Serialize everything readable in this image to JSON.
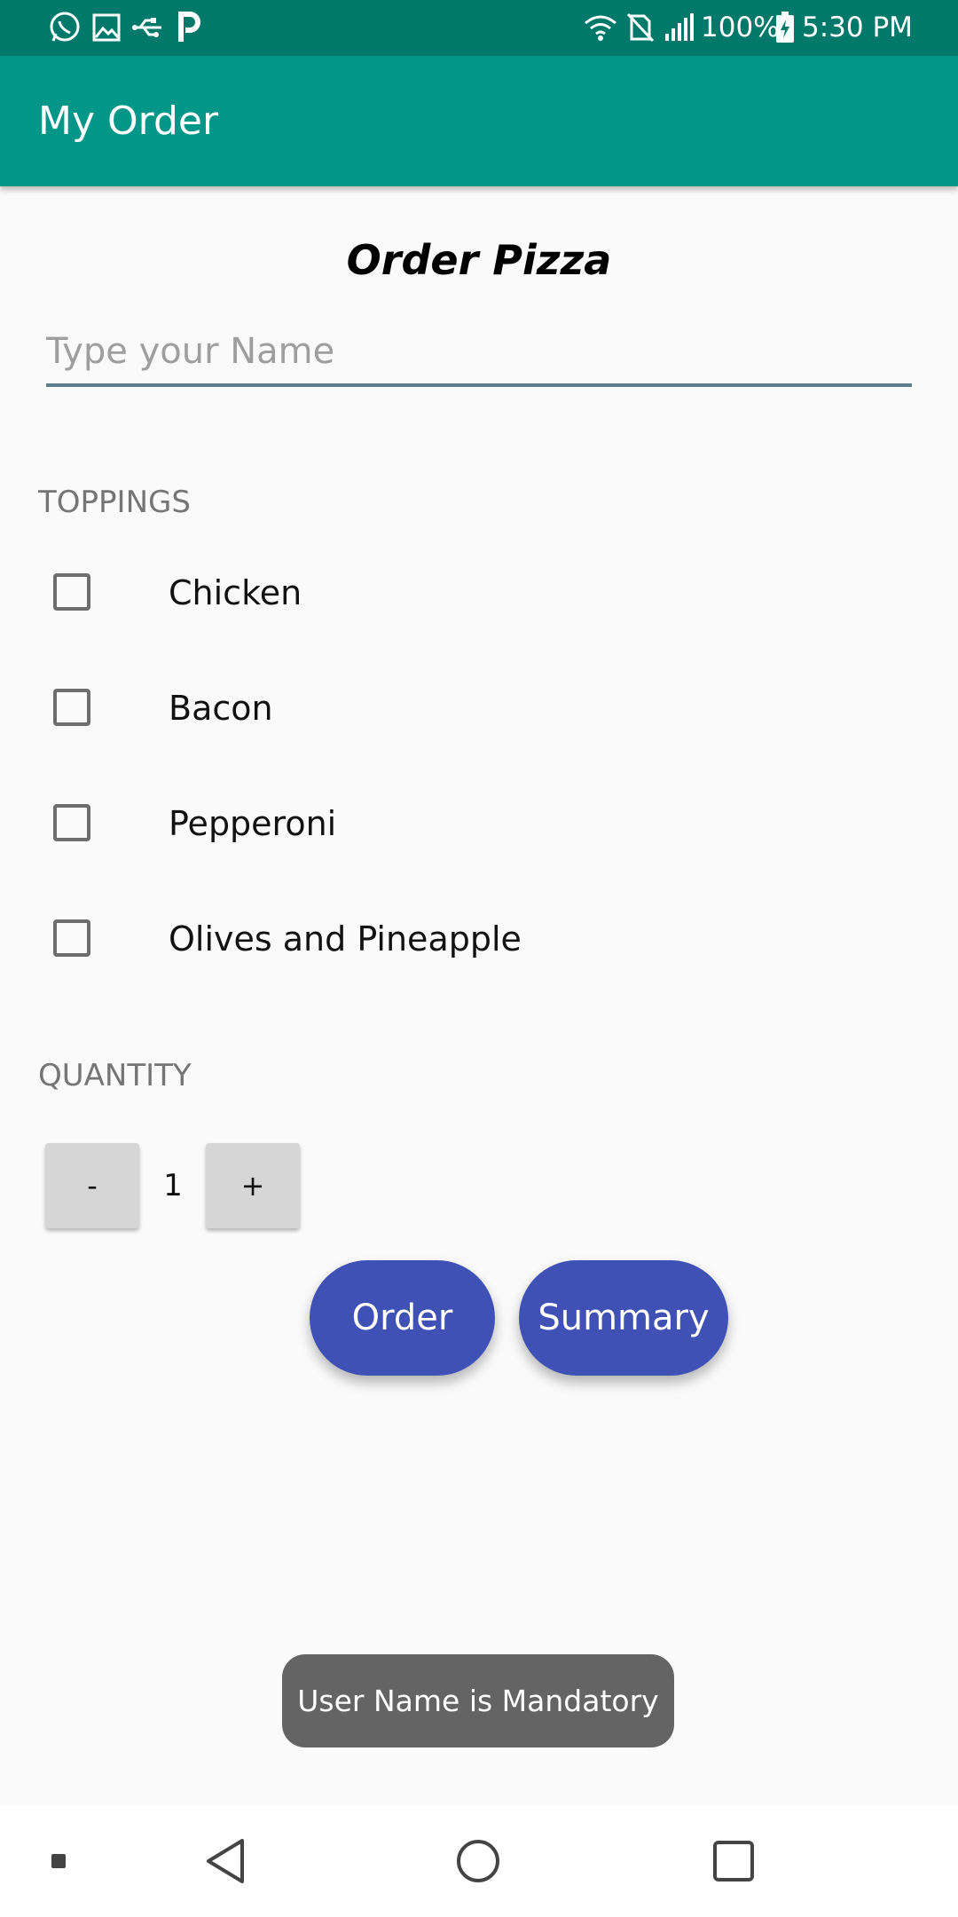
{
  "status_bar": {
    "battery": "100%",
    "time": "5:30 PM",
    "icons": [
      "whatsapp-icon",
      "image-icon",
      "usb-icon",
      "p-app-icon",
      "wifi-icon",
      "no-sim-icon",
      "signal-icon",
      "battery-charging-icon"
    ]
  },
  "app_bar": {
    "title": "My Order"
  },
  "form": {
    "heading": "Order Pizza",
    "name_placeholder": "Type your Name",
    "name_value": ""
  },
  "toppings": {
    "label": "TOPPINGS",
    "items": [
      {
        "label": "Chicken",
        "checked": false
      },
      {
        "label": "Bacon",
        "checked": false
      },
      {
        "label": "Pepperoni",
        "checked": false
      },
      {
        "label": "Olives and Pineapple",
        "checked": false
      }
    ]
  },
  "quantity": {
    "label": "QUANTITY",
    "decrement_label": "-",
    "value": "1",
    "increment_label": "+"
  },
  "actions": {
    "order_label": "Order",
    "summary_label": "Summary"
  },
  "toast": {
    "message": "User Name is Mandatory"
  },
  "colors": {
    "status_bar": "#00796b",
    "app_bar": "#009688",
    "accent_button": "#3f51b5",
    "toast": "#646464"
  }
}
